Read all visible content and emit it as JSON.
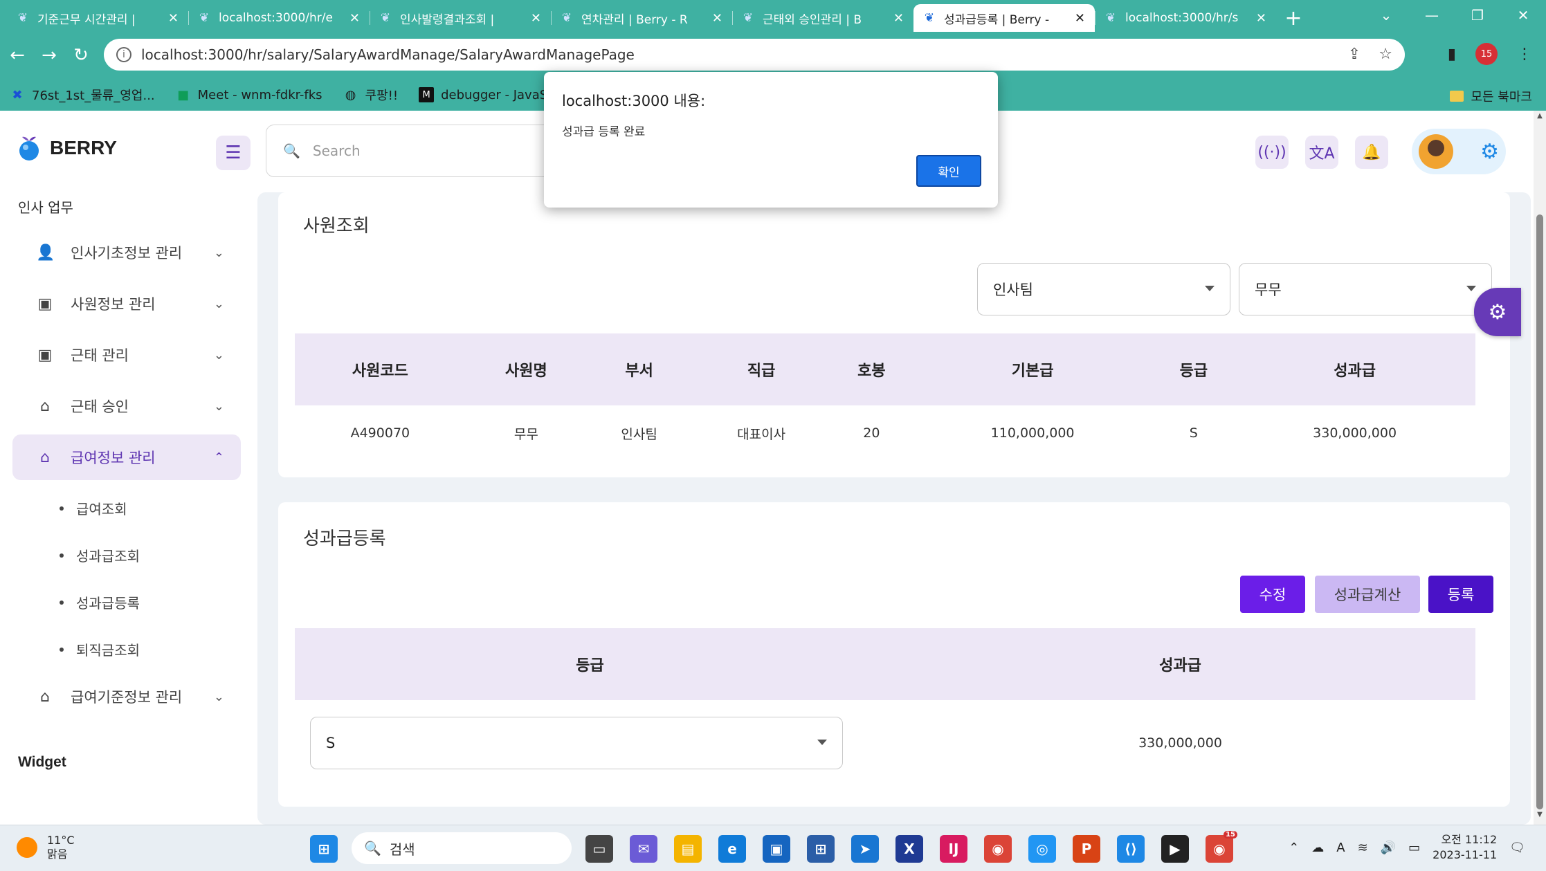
{
  "browser": {
    "tabs": [
      {
        "title": "기준근무 시간관리 |",
        "active": false
      },
      {
        "title": "localhost:3000/hr/e",
        "active": false
      },
      {
        "title": "인사발령결과조회 |",
        "active": false
      },
      {
        "title": "연차관리 | Berry - R",
        "active": false
      },
      {
        "title": "근태외 승인관리 | B",
        "active": false
      },
      {
        "title": "성과급등록 | Berry -",
        "active": true
      },
      {
        "title": "localhost:3000/hr/s",
        "active": false
      }
    ],
    "url": "localhost:3000/hr/salary/SalaryAwardManage/SalaryAwardManagePage",
    "profile_badge": "15",
    "bookmarks": [
      {
        "label": "76st_1st_물류_영업...",
        "icon": "x-logo-icon"
      },
      {
        "label": "Meet - wnm-fdkr-fks",
        "icon": "meet-icon"
      },
      {
        "label": "쿠팡!!",
        "icon": "globe-icon"
      },
      {
        "label": "debugger - JavaScr...",
        "icon": "mdn-icon"
      }
    ],
    "bookmarks_folder": "모든 북마크"
  },
  "app": {
    "brand": "BERRY",
    "search_placeholder": "Search",
    "sidebar": {
      "section_title": "인사 업무",
      "items": [
        {
          "label": "인사기초정보 관리",
          "icon": "user-check-icon",
          "chevron": "⌄",
          "active": false
        },
        {
          "label": "사원정보 관리",
          "icon": "brand-icon",
          "chevron": "⌄",
          "active": false
        },
        {
          "label": "근태 관리",
          "icon": "brand-icon",
          "chevron": "⌄",
          "active": false
        },
        {
          "label": "근태 승인",
          "icon": "basket-icon",
          "chevron": "⌄",
          "active": false
        },
        {
          "label": "급여정보 관리",
          "icon": "basket-icon",
          "chevron": "⌃",
          "active": true
        }
      ],
      "subitems": [
        "급여조회",
        "성과급조회",
        "성과급등록",
        "퇴직금조회"
      ],
      "extra_item": {
        "label": "급여기준정보 관리",
        "icon": "basket-icon",
        "chevron": "⌄"
      },
      "widget_title": "Widget"
    },
    "employee_card": {
      "title": "사원조회",
      "dept_select": "인사팀",
      "name_select": "무무",
      "columns": [
        "사원코드",
        "사원명",
        "부서",
        "직급",
        "호봉",
        "기본급",
        "등급",
        "성과급"
      ],
      "rows": [
        [
          "A490070",
          "무무",
          "인사팀",
          "대표이사",
          "20",
          "110,000,000",
          "S",
          "330,000,000"
        ]
      ]
    },
    "award_card": {
      "title": "성과급등록",
      "buttons": {
        "edit": "수정",
        "calc": "성과급계산",
        "register": "등록"
      },
      "columns": [
        "등급",
        "성과급"
      ],
      "grade_select": "S",
      "award_value": "330,000,000"
    }
  },
  "alert": {
    "title": "localhost:3000 내용:",
    "message": "성과급 등록 완료",
    "ok": "확인"
  },
  "taskbar": {
    "weather_temp": "11°C",
    "weather_desc": "맑음",
    "search_label": "검색",
    "time": "오전 11:12",
    "date": "2023-11-11",
    "chrome_badge": "15"
  },
  "colors": {
    "accent": "#673ab7",
    "chrome": "#3fb1a2",
    "header_bg": "#ede7f6",
    "button_primary": "#6b1ee8"
  }
}
